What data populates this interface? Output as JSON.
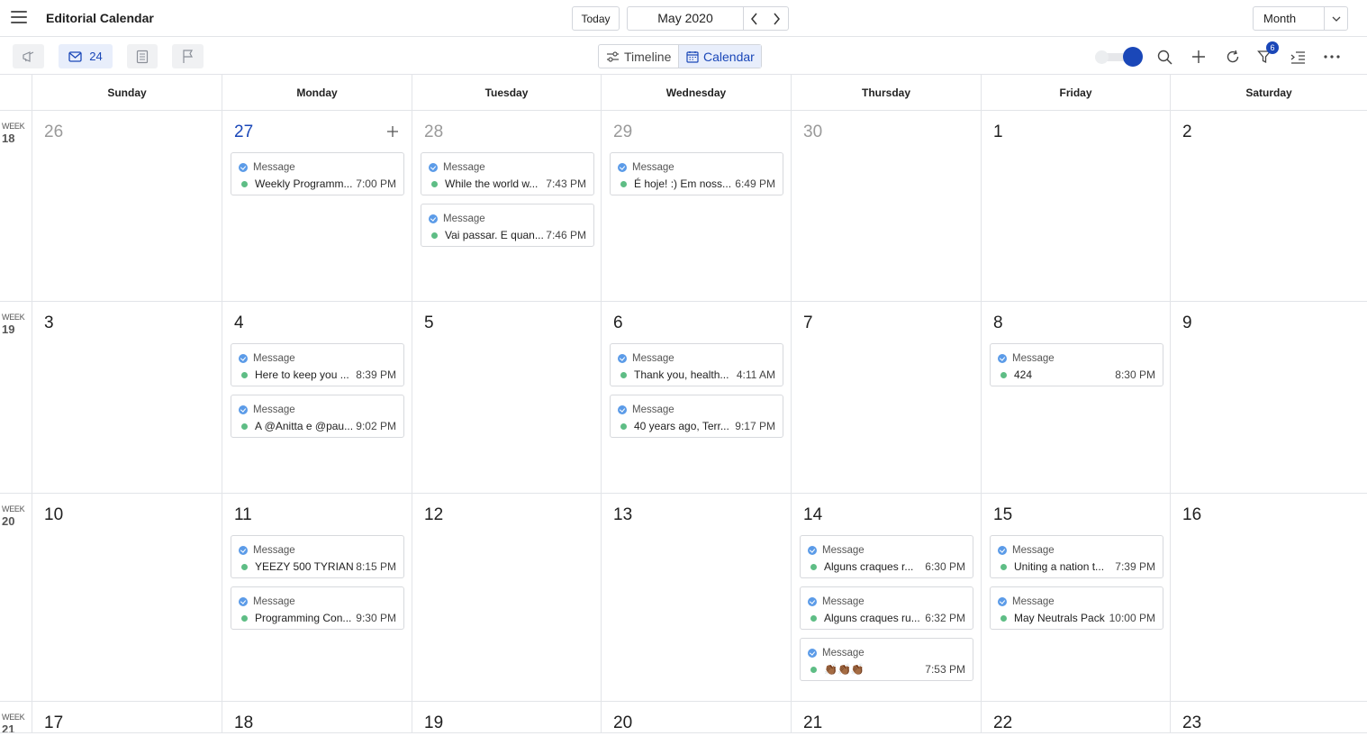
{
  "header": {
    "title": "Editorial Calendar",
    "today_label": "Today",
    "month_label": "May 2020",
    "view_label": "Month"
  },
  "toolbar": {
    "inbox_count": "24",
    "filter_badge": "6",
    "timeline_label": "Timeline",
    "calendar_label": "Calendar",
    "accent_color": "#1a47b8"
  },
  "days": [
    "Sunday",
    "Monday",
    "Tuesday",
    "Wednesday",
    "Thursday",
    "Friday",
    "Saturday"
  ],
  "weeks": [
    {
      "week_word": "WEEK",
      "number": "18",
      "days": [
        {
          "d": "26",
          "other": true,
          "events": []
        },
        {
          "d": "27",
          "today": true,
          "events": [
            {
              "type": "Message",
              "title": "Weekly Programm...",
              "time": "7:00 PM"
            }
          ]
        },
        {
          "d": "28",
          "other": true,
          "events": [
            {
              "type": "Message",
              "title": "While the world w...",
              "time": "7:43 PM"
            },
            {
              "type": "Message",
              "title": "Vai passar. E quan...",
              "time": "7:46 PM"
            }
          ]
        },
        {
          "d": "29",
          "other": true,
          "events": [
            {
              "type": "Message",
              "title": "É hoje! :) Em noss...",
              "time": "6:49 PM"
            }
          ]
        },
        {
          "d": "30",
          "other": true,
          "events": []
        },
        {
          "d": "1",
          "events": []
        },
        {
          "d": "2",
          "events": []
        }
      ]
    },
    {
      "week_word": "WEEK",
      "number": "19",
      "days": [
        {
          "d": "3",
          "events": []
        },
        {
          "d": "4",
          "events": [
            {
              "type": "Message",
              "title": "Here to keep you ...",
              "time": "8:39 PM"
            },
            {
              "type": "Message",
              "title": "A @Anitta e @pau...",
              "time": "9:02 PM"
            }
          ]
        },
        {
          "d": "5",
          "events": []
        },
        {
          "d": "6",
          "events": [
            {
              "type": "Message",
              "title": "Thank you, health...",
              "time": "4:11 AM"
            },
            {
              "type": "Message",
              "title": "40 years ago, Terr...",
              "time": "9:17 PM"
            }
          ]
        },
        {
          "d": "7",
          "events": []
        },
        {
          "d": "8",
          "events": [
            {
              "type": "Message",
              "title": "424",
              "time": "8:30 PM"
            }
          ]
        },
        {
          "d": "9",
          "events": []
        }
      ]
    },
    {
      "week_word": "WEEK",
      "number": "20",
      "days": [
        {
          "d": "10",
          "events": []
        },
        {
          "d": "11",
          "events": [
            {
              "type": "Message",
              "title": "YEEZY 500 TYRIAN",
              "time": "8:15 PM"
            },
            {
              "type": "Message",
              "title": "Programming Con...",
              "time": "9:30 PM"
            }
          ]
        },
        {
          "d": "12",
          "events": []
        },
        {
          "d": "13",
          "events": []
        },
        {
          "d": "14",
          "events": [
            {
              "type": "Message",
              "title": "Alguns craques r...",
              "time": "6:30 PM"
            },
            {
              "type": "Message",
              "title": "Alguns craques ru...",
              "time": "6:32 PM"
            },
            {
              "type": "Message",
              "title": "👏🏾👏🏾👏🏾",
              "time": "7:53 PM"
            }
          ]
        },
        {
          "d": "15",
          "events": [
            {
              "type": "Message",
              "title": "Uniting a nation t...",
              "time": "7:39 PM"
            },
            {
              "type": "Message",
              "title": "May Neutrals Pack",
              "time": "10:00 PM"
            }
          ]
        },
        {
          "d": "16",
          "events": []
        }
      ]
    },
    {
      "week_word": "WEEK",
      "number": "21",
      "days": [
        {
          "d": "17",
          "events": []
        },
        {
          "d": "18",
          "events": []
        },
        {
          "d": "19",
          "events": []
        },
        {
          "d": "20",
          "events": []
        },
        {
          "d": "21",
          "events": []
        },
        {
          "d": "22",
          "events": []
        },
        {
          "d": "23",
          "events": []
        }
      ]
    }
  ]
}
